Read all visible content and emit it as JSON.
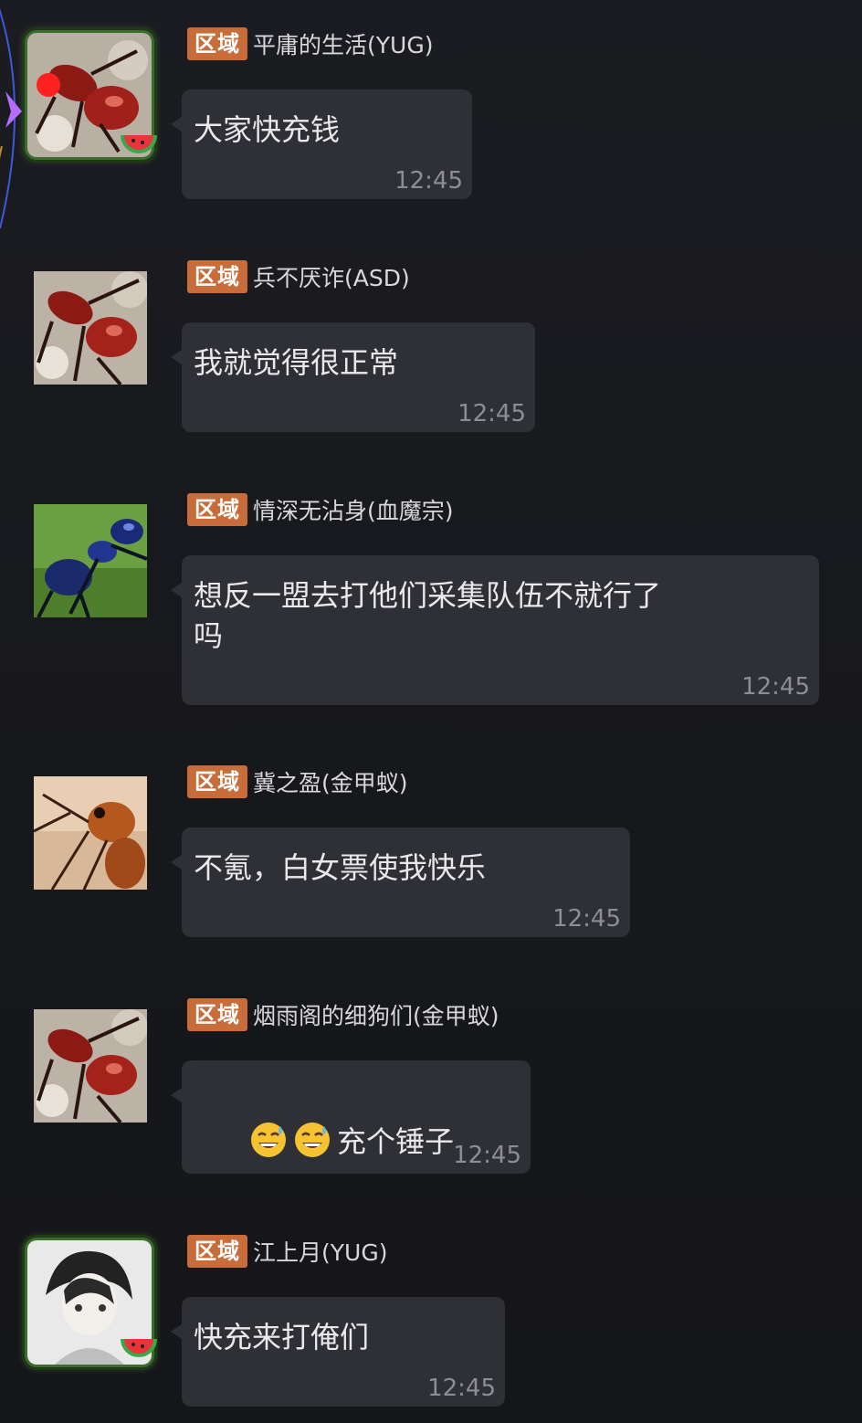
{
  "messages": [
    {
      "channel": "区域",
      "sender": "平庸的生活(YUG)",
      "text": "大家快充钱",
      "time": "12:45",
      "avatar": "red-ant-framed"
    },
    {
      "channel": "区域",
      "sender": "兵不厌诈(ASD)",
      "text": "我就觉得很正常",
      "time": "12:45",
      "avatar": "red-ant"
    },
    {
      "channel": "区域",
      "sender": "情深无沾身(血魔宗)",
      "text": "想反一盟去打他们采集队伍不就行了\n吗",
      "time": "12:45",
      "avatar": "blue-ant"
    },
    {
      "channel": "区域",
      "sender": "冀之盈(金甲蚁)",
      "text": "不氪，白女票使我快乐",
      "time": "12:45",
      "avatar": "orange-ant"
    },
    {
      "channel": "区域",
      "sender": "烟雨阁的细狗们(金甲蚁)",
      "text": "充个锤子",
      "emojis": [
        "sweat-smile-emoji",
        "sweat-smile-emoji"
      ],
      "time": "12:45",
      "avatar": "red-ant"
    },
    {
      "channel": "区域",
      "sender": "江上月(YUG)",
      "text": "快充来打俺们",
      "time": "12:45",
      "avatar": "anime-boy-framed"
    }
  ],
  "colors": {
    "background": "#17181c",
    "bubble": "#2f3036",
    "channel_tag": "#c86d3a",
    "text": "#e9e9ec",
    "time": "#8d8e93",
    "unread_dot": "#ff2020"
  }
}
